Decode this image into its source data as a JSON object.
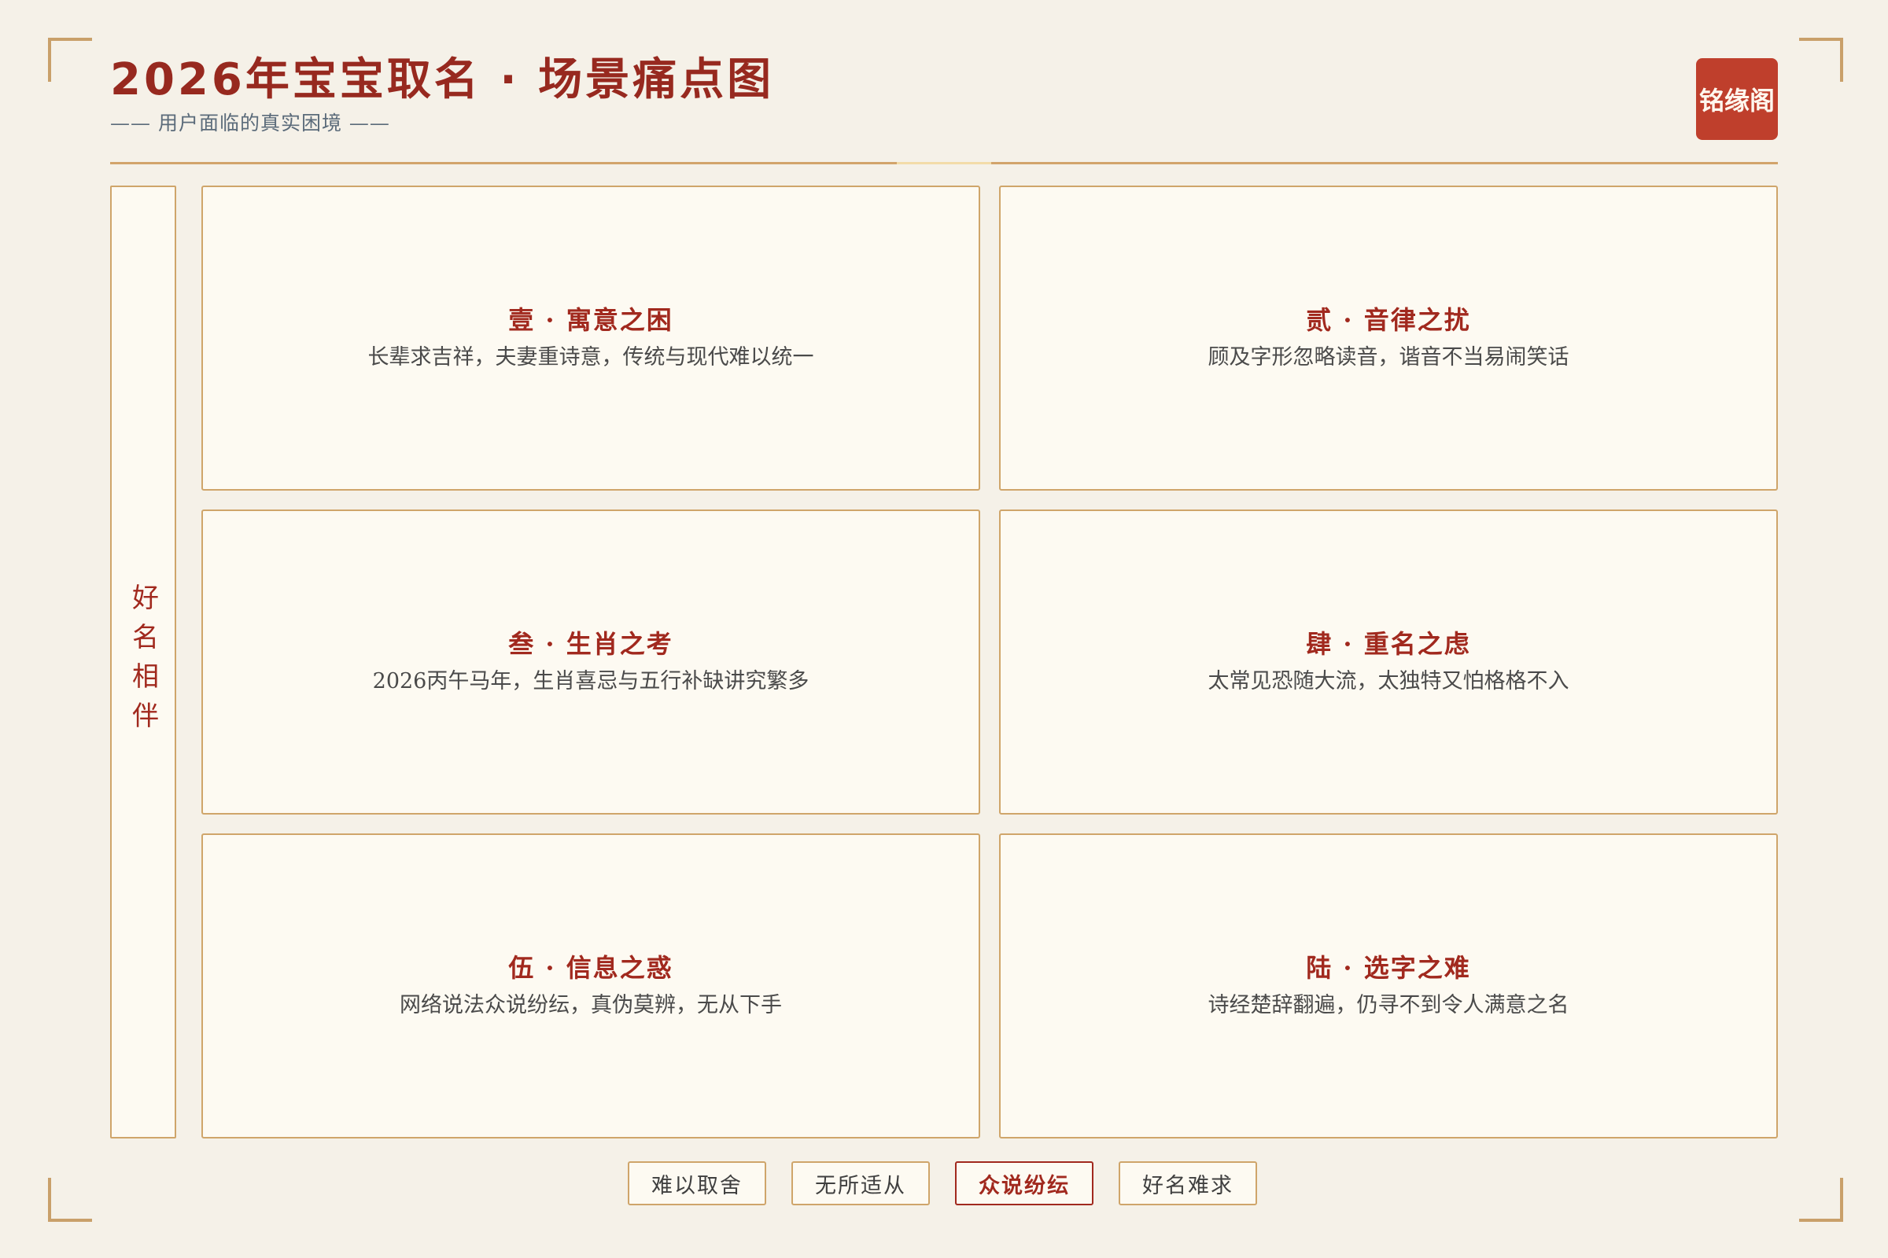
{
  "header": {
    "title": "2026年宝宝取名 · 场景痛点图",
    "subtitle": "—— 用户面临的真实困境 ——",
    "brand": "铭缘阁"
  },
  "side": {
    "label": "好名相伴"
  },
  "cards": [
    {
      "title": "壹 · 寓意之困",
      "desc": "长辈求吉祥，夫妻重诗意，传统与现代难以统一"
    },
    {
      "title": "贰 · 音律之扰",
      "desc": "顾及字形忽略读音，谐音不当易闹笑话"
    },
    {
      "title": "叁 · 生肖之考",
      "desc": "2026丙午马年，生肖喜忌与五行补缺讲究繁多"
    },
    {
      "title": "肆 · 重名之虑",
      "desc": "太常见恐随大流，太独特又怕格格不入"
    },
    {
      "title": "伍 · 信息之惑",
      "desc": "网络说法众说纷纭，真伪莫辨，无从下手"
    },
    {
      "title": "陆 · 选字之难",
      "desc": "诗经楚辞翻遍，仍寻不到令人满意之名"
    }
  ],
  "tags": [
    {
      "label": "难以取舍"
    },
    {
      "label": "无所适从"
    },
    {
      "label": "众说纷纭",
      "active": true
    },
    {
      "label": "好名难求"
    }
  ],
  "colors": {
    "accent": "#97291f",
    "seal": "#bf3f2c",
    "border": "#cfa56a",
    "background": "#f5f1e8",
    "card_background": "#fdfaf2"
  }
}
